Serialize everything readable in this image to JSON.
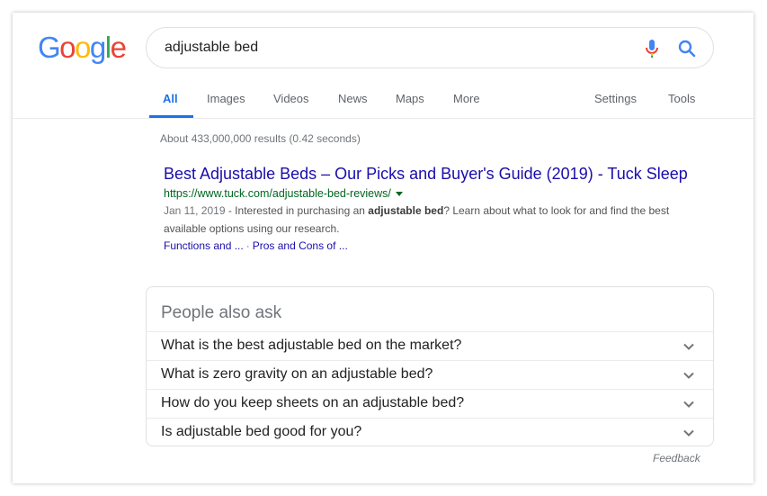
{
  "logo": {
    "letters": [
      "G",
      "o",
      "o",
      "g",
      "l",
      "e"
    ],
    "colors": [
      "#4285f4",
      "#ea4335",
      "#fbbc05",
      "#4285f4",
      "#34a853",
      "#ea4335"
    ]
  },
  "search": {
    "query": "adjustable bed"
  },
  "tabs": [
    {
      "label": "All",
      "active": true
    },
    {
      "label": "Images"
    },
    {
      "label": "Videos"
    },
    {
      "label": "News"
    },
    {
      "label": "Maps"
    },
    {
      "label": "More"
    },
    {
      "label": "Settings"
    },
    {
      "label": "Tools"
    }
  ],
  "stats": "About 433,000,000 results (0.42 seconds)",
  "result": {
    "title": "Best Adjustable Beds – Our Picks and Buyer's Guide (2019) - Tuck Sleep",
    "url": "https://www.tuck.com/adjustable-bed-reviews/",
    "date": "Jan 11, 2019",
    "snippet_pre": " - Interested in purchasing an ",
    "snippet_bold": "adjustable bed",
    "snippet_post": "? Learn about what to look for and find the best available options using our research.",
    "sitelinks": [
      "Functions and ...",
      "Pros and Cons of ..."
    ],
    "sitelink_sep": "·"
  },
  "paa": {
    "title": "People also ask",
    "questions": [
      "What is the best adjustable bed on the market?",
      "What is zero gravity on an adjustable bed?",
      "How do you keep sheets on an adjustable bed?",
      "Is adjustable bed good for you?"
    ]
  },
  "feedback": "Feedback",
  "colors": {
    "link": "#1a0dab",
    "url": "#006621",
    "accent": "#1a73e8"
  }
}
